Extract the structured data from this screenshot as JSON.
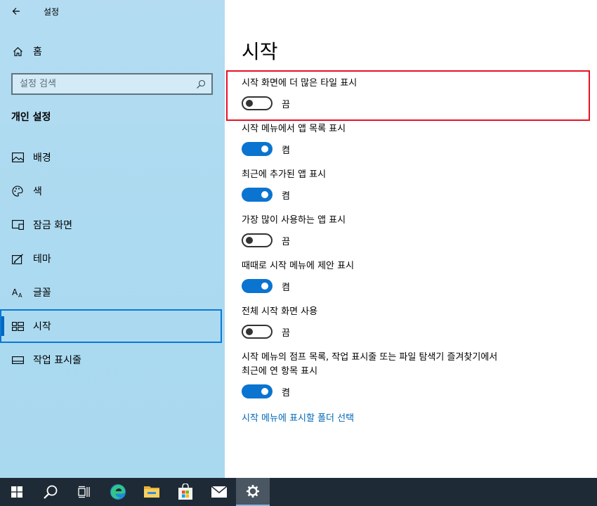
{
  "window": {
    "title": "설정"
  },
  "sidebar": {
    "home_label": "홈",
    "search_placeholder": "설정 검색",
    "section_title": "개인 설정",
    "items": [
      {
        "label": "배경",
        "icon": "picture-icon"
      },
      {
        "label": "색",
        "icon": "palette-icon"
      },
      {
        "label": "잠금 화면",
        "icon": "lock-screen-icon"
      },
      {
        "label": "테마",
        "icon": "theme-icon"
      },
      {
        "label": "글꼴",
        "icon": "font-icon"
      },
      {
        "label": "시작",
        "icon": "start-icon",
        "selected": true
      },
      {
        "label": "작업 표시줄",
        "icon": "taskbar-icon"
      }
    ]
  },
  "main": {
    "title": "시작",
    "settings": [
      {
        "caption": "시작 화면에 더 많은 타일 표시",
        "on": false,
        "state": "끔",
        "highlighted": true
      },
      {
        "caption": "시작 메뉴에서 앱 목록 표시",
        "on": true,
        "state": "켬"
      },
      {
        "caption": "최근에 추가된 앱 표시",
        "on": true,
        "state": "켬"
      },
      {
        "caption": "가장 많이 사용하는 앱 표시",
        "on": false,
        "state": "끔"
      },
      {
        "caption": "때때로 시작 메뉴에 제안 표시",
        "on": true,
        "state": "켬"
      },
      {
        "caption": "전체 시작 화면 사용",
        "on": false,
        "state": "끔"
      },
      {
        "caption_line1": "시작 메뉴의 점프 목록, 작업 표시줄 또는 파일 탐색기 즐겨찾기에서",
        "caption_line2": "최근에 연 항목 표시",
        "on": true,
        "state": "켬"
      }
    ],
    "folder_link": "시작 메뉴에 표시할 폴더 선택"
  },
  "taskbar": {
    "items": [
      "windows-start-icon",
      "search-icon",
      "task-view-icon",
      "edge-icon",
      "file-explorer-icon",
      "store-icon",
      "mail-icon",
      "settings-gear-icon"
    ]
  },
  "colors": {
    "accent": "#0a74d0",
    "highlight_box": "#e81123",
    "taskbar": "#1e2b36"
  }
}
